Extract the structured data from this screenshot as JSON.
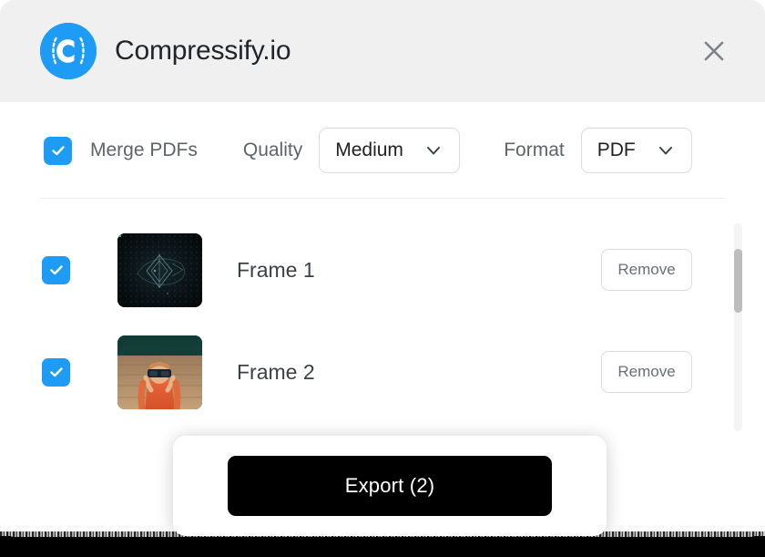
{
  "window": {
    "brand_name": "Compressify.io",
    "logo_icon": "compressify-logo-icon",
    "close_icon": "close-icon"
  },
  "toolbar": {
    "merge": {
      "label": "Merge PDFs",
      "checked": true,
      "check_icon": "checkmark-icon"
    },
    "quality": {
      "label": "Quality",
      "value": "Medium",
      "chevron_icon": "chevron-down-icon",
      "options": [
        "Medium"
      ]
    },
    "format": {
      "label": "Format",
      "value": "PDF",
      "chevron_icon": "chevron-down-icon",
      "options": [
        "PDF"
      ]
    }
  },
  "files": {
    "remove_label": "Remove",
    "items": [
      {
        "name": "Frame 1",
        "checked": true,
        "thumbnail": "dark-geometric-thumbnail"
      },
      {
        "name": "Frame 2",
        "checked": true,
        "thumbnail": "person-with-binoculars-thumbnail"
      }
    ]
  },
  "footer": {
    "export_label": "Export (2)"
  },
  "colors": {
    "accent": "#1e9bf5",
    "header_bg": "#f0f0f0",
    "export_bg": "#000000",
    "border": "#dcdcdc",
    "text_primary": "#202124",
    "text_secondary": "#5f6368"
  }
}
